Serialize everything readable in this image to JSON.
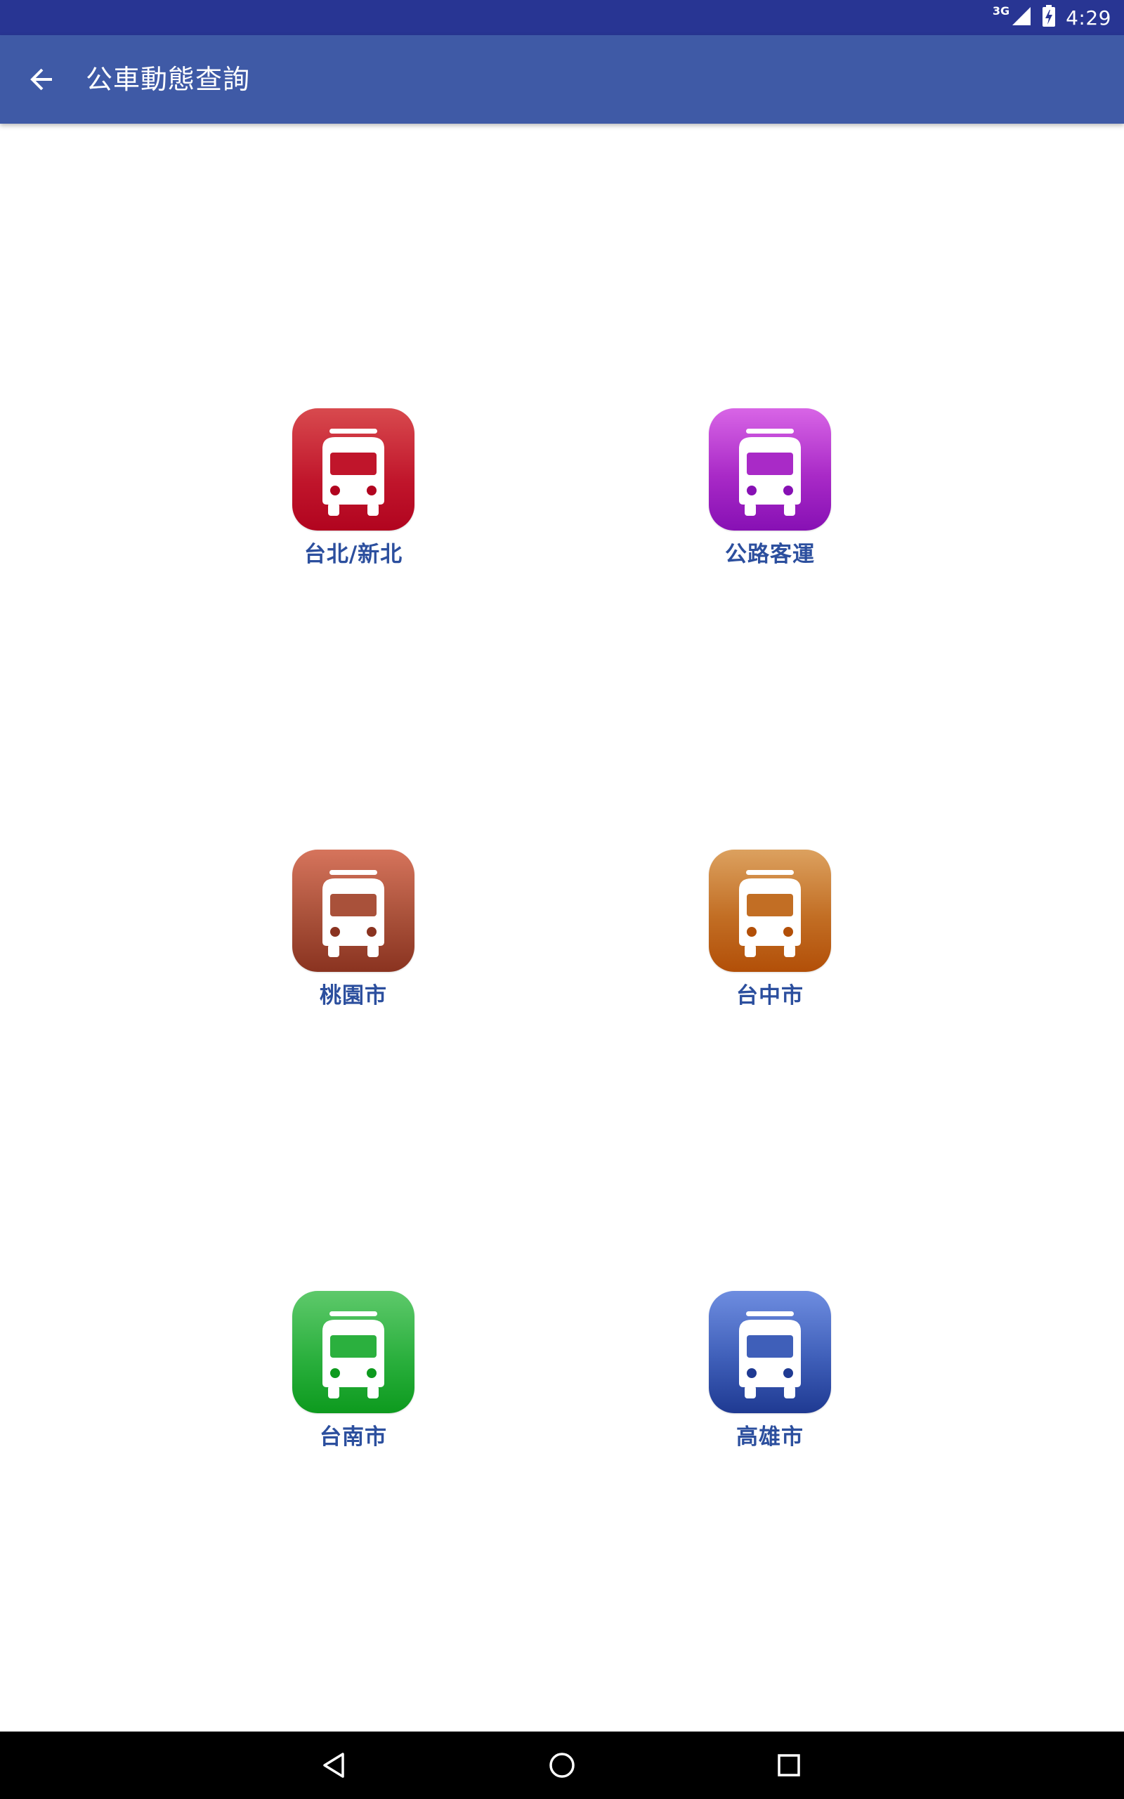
{
  "status_bar": {
    "network_type": "3G",
    "time": "4:29",
    "background": "#283593"
  },
  "app_bar": {
    "title": "公車動態查詢",
    "background": "#3f5aa6",
    "back_icon": "arrow-back-icon"
  },
  "tiles": [
    {
      "label": "台北/新北",
      "icon": "bus-icon",
      "color": "#c0152b"
    },
    {
      "label": "公路客運",
      "icon": "bus-icon",
      "color": "#a92ac7"
    },
    {
      "label": "桃園市",
      "icon": "bus-icon",
      "color": "#a9513a"
    },
    {
      "label": "台中市",
      "icon": "bus-icon",
      "color": "#c26e24"
    },
    {
      "label": "台南市",
      "icon": "bus-icon",
      "color": "#2bb03e"
    },
    {
      "label": "高雄市",
      "icon": "bus-icon",
      "color": "#3f5fb9"
    }
  ],
  "nav_bar": {
    "buttons": [
      "back-triangle-icon",
      "home-circle-icon",
      "recents-square-icon"
    ]
  },
  "label_color": "#2c4f9e"
}
